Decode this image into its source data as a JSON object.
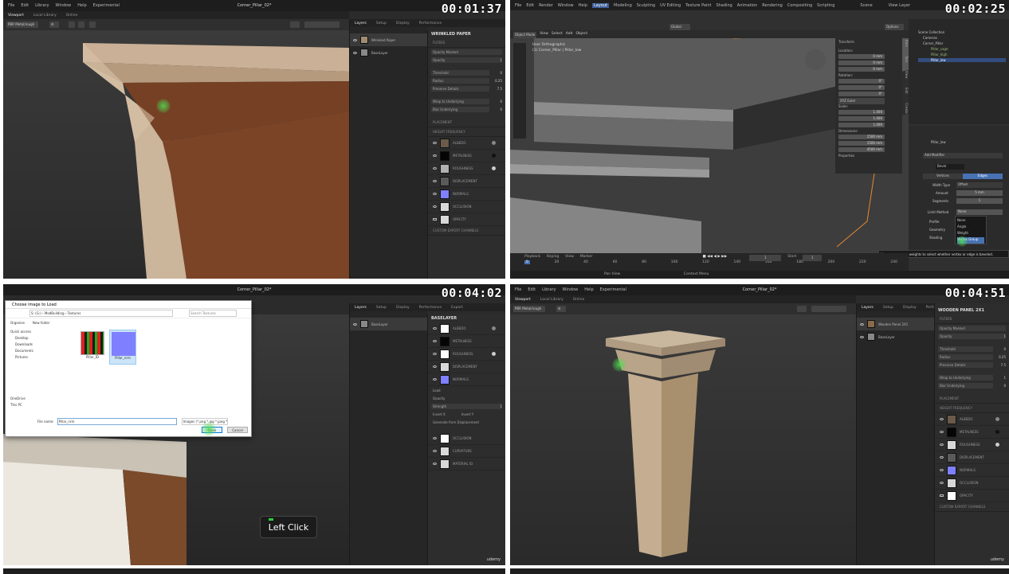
{
  "panels": [
    {
      "timestamp": "00:01:37",
      "app_title": "Corner_Pillar_02*",
      "menu": [
        "File",
        "Edit",
        "Library",
        "Window",
        "Help",
        "Experimental"
      ],
      "tabs": [
        "Viewport",
        "Local Library",
        "Online"
      ],
      "dropdown": "PBR Metal/rough",
      "right_tabs": [
        "Layers",
        "Setup",
        "Display",
        "Performance"
      ],
      "layers": [
        "Wrinkled Paper",
        "BaseLayer"
      ],
      "props_title": "WRINKLED PAPER",
      "section_filter": "FILTERS",
      "blend": "Opacity Masked",
      "opacity": "Opacity",
      "opacity_val": "1",
      "params": [
        {
          "label": "Threshold",
          "val": "0"
        },
        {
          "label": "Radius",
          "val": "0.25"
        },
        {
          "label": "Preserve Details",
          "val": "7.5"
        },
        {
          "label": "Wrap to Underlying",
          "val": "0"
        },
        {
          "label": "Blur Underlying",
          "val": "0"
        }
      ],
      "sections": [
        "PLACEMENT",
        "HEIGHT FREQUENCY",
        "CUSTOM EXPORT CHANNELS"
      ],
      "channels": [
        "ALBEDO",
        "METALNESS",
        "ROUGHNESS",
        "DISPLACEMENT",
        "NORMALS",
        "OCCLUSION",
        "OPACITY"
      ],
      "channel_colors": [
        "#6b5a4a",
        "#050505",
        "#b0b0b0",
        "#5a5a5a",
        "#7f80ff",
        "#d8d8d8",
        "#d8d8d8"
      ],
      "logo": "udemy"
    },
    {
      "timestamp": "00:02:25",
      "menu": [
        "File",
        "Edit",
        "Render",
        "Window",
        "Help"
      ],
      "workspaces": [
        "Layout",
        "Modeling",
        "Sculpting",
        "UV Editing",
        "Texture Paint",
        "Shading",
        "Animation",
        "Rendering",
        "Compositing",
        "Scripting"
      ],
      "scene": "Scene",
      "view_layer": "View Layer",
      "mode": "Object Mode",
      "header_menu": [
        "View",
        "Select",
        "Add",
        "Object"
      ],
      "transform_orient": "Global",
      "view_label": "User Orthographic",
      "view_sub": "(1) Corner_Pillar | Pillar_low",
      "options": "Options",
      "n_panel": {
        "transform": "Transform",
        "location": "Location:",
        "loc": [
          {
            "axis": "X",
            "val": "0 mm"
          },
          {
            "axis": "Y",
            "val": "0 mm"
          },
          {
            "axis": "Z",
            "val": "0 mm"
          }
        ],
        "rotation": "Rotation:",
        "rot": [
          {
            "axis": "X",
            "val": "0°"
          },
          {
            "axis": "Y",
            "val": "0°"
          },
          {
            "axis": "Z",
            "val": "0°"
          }
        ],
        "rot_mode": "XYZ Euler",
        "scale": "Scale:",
        "scl": [
          {
            "axis": "X",
            "val": "1.000"
          },
          {
            "axis": "Y",
            "val": "1.000"
          },
          {
            "axis": "Z",
            "val": "1.000"
          }
        ],
        "dimensions": "Dimensions:",
        "dim": [
          {
            "axis": "X",
            "val": "1500 mm"
          },
          {
            "axis": "Y",
            "val": "1500 mm"
          },
          {
            "axis": "Z",
            "val": "4500 mm"
          }
        ],
        "properties": "Properties",
        "vtabs": [
          "Item",
          "Tool",
          "View",
          "Edit",
          "Create"
        ]
      },
      "outliner": {
        "title": "Scene Collection",
        "items": [
          "Cameras",
          "Corner_Pillar",
          "Pillar_cage",
          "Pillar_high",
          "Pillar_low"
        ]
      },
      "modifier": {
        "object": "Pillar_low",
        "add": "Add Modifier",
        "name": "Bevel",
        "tabs": [
          "Vertices",
          "Edges"
        ],
        "width_type_label": "Width Type",
        "width_type": "Offset",
        "amount_label": "Amount",
        "amount": "5 mm",
        "segments_label": "Segments",
        "segments": "1",
        "limit_label": "Limit Method",
        "limit": "None",
        "subsections": [
          "Profile",
          "Geometry",
          "Shading"
        ],
        "dropdown_items": [
          "None",
          "Angle",
          "Weight",
          "Vertex Group"
        ],
        "tooltip": "Use vertex group weights to select whether vertex or edge is beveled."
      },
      "timeline": {
        "menu": [
          "Playback",
          "Keying",
          "View",
          "Marker"
        ],
        "frame": "1",
        "start_label": "Start",
        "start": "1",
        "ticks": [
          "0",
          "20",
          "40",
          "60",
          "80",
          "100",
          "120",
          "140",
          "160",
          "180",
          "200",
          "220",
          "240"
        ],
        "status_left": "Pan View",
        "status_right": "Context Menu"
      }
    },
    {
      "timestamp": "00:04:02",
      "dialog": {
        "title": "Choose image to Load",
        "path": "S: (G:) › ModBuilding › Textures",
        "search": "Search Textures",
        "organise": "Organise",
        "new_folder": "New folder",
        "tree": [
          "Quick access",
          "Desktop",
          "Downloads",
          "Documents",
          "Pictures",
          "OneDrive",
          "This PC"
        ],
        "files": [
          "Pillar_ID",
          "Pillar_nrm"
        ],
        "filename_label": "File name:",
        "filename": "Pillar_nrm",
        "filter": "Images (*.png *.jpg *.jpeg *.tif)",
        "open": "Open",
        "cancel": "Cancel"
      },
      "app_title": "Corner_Pillar_02*",
      "right_tabs": [
        "Layers",
        "Setup",
        "Display",
        "Performance",
        "Export"
      ],
      "layer": "BaseLayer",
      "props_title": "BASELAYER",
      "channels_top": [
        "ALBEDO",
        "METALNESS",
        "ROUGHNESS",
        "DISPLACEMENT",
        "NORMALS"
      ],
      "normals_opts": [
        "Load",
        "Opacity",
        "Strength",
        "Invert X",
        "Invert Y",
        "Generate from Displacement"
      ],
      "strength_val": "1",
      "channels_bottom": [
        "OCCLUSION",
        "CURVATURE",
        "MATERIAL ID"
      ],
      "channel_colors_top": [
        "#ffffff",
        "#050505",
        "#ffffff",
        "#d8d8d8",
        "#7f80ff"
      ],
      "channel_colors_bottom": [
        "#ffffff",
        "#d8d8d8",
        "#d8d8d8"
      ],
      "tooltip_action": "Left Click",
      "logo": "udemy"
    },
    {
      "timestamp": "00:04:51",
      "app_title": "Corner_Pillar_02*",
      "menu": [
        "File",
        "Edit",
        "Library",
        "Window",
        "Help",
        "Experimental"
      ],
      "tabs": [
        "Viewport",
        "Local Library",
        "Online"
      ],
      "dropdown": "PBR Metal/rough",
      "right_tabs": [
        "Layers",
        "Setup",
        "Display",
        "Performance",
        "Export"
      ],
      "layers": [
        "Wooden Panel 2X1",
        "BaseLayer"
      ],
      "props_title": "WOODEN PANEL 2X1",
      "section_filter": "FILTERS",
      "blend": "Opacity Masked",
      "opacity": "Opacity",
      "opacity_val": "1",
      "params": [
        {
          "label": "Threshold",
          "val": "0"
        },
        {
          "label": "Radius",
          "val": "0.25"
        },
        {
          "label": "Preserve Details",
          "val": "7.5"
        },
        {
          "label": "Wrap to Underlying",
          "val": "1"
        },
        {
          "label": "Blur Underlying",
          "val": "0"
        }
      ],
      "sections": [
        "PLACEMENT",
        "HEIGHT FREQUENCY",
        "CUSTOM EXPORT CHANNELS"
      ],
      "channels": [
        "ALBEDO",
        "METALNESS",
        "ROUGHNESS",
        "DISPLACEMENT",
        "NORMALS",
        "OCCLUSION",
        "OPACITY"
      ],
      "channel_colors": [
        "#6b5a4a",
        "#050505",
        "#d8d8d8",
        "#5a5a5a",
        "#7f80ff",
        "#d8d8d8",
        "#ffffff"
      ],
      "logo": "udemy"
    }
  ]
}
